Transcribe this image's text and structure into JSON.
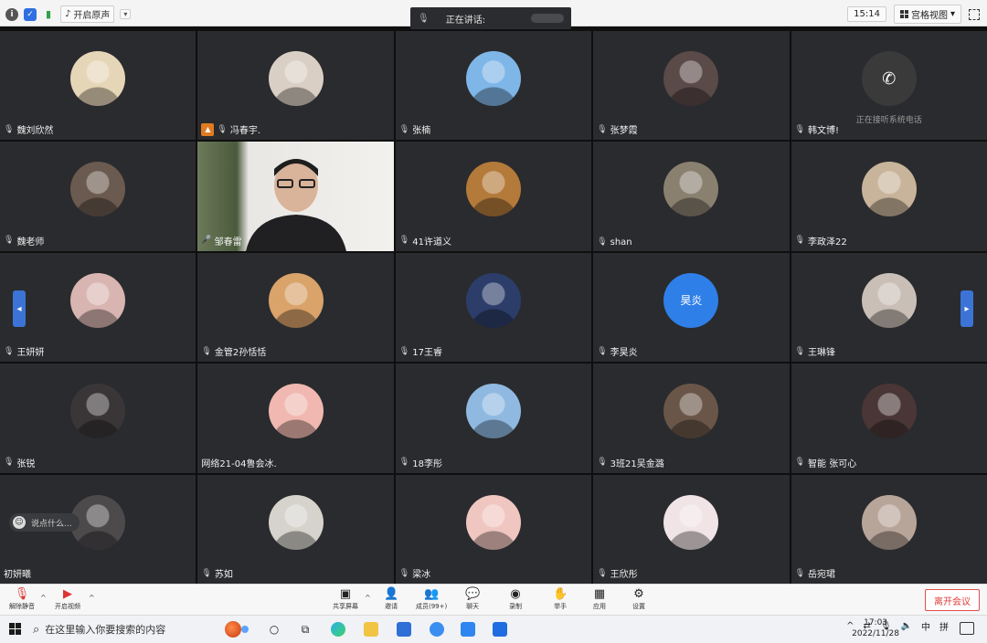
{
  "topbar": {
    "sound_label": "开启原声",
    "speaking_label": "正在讲话:",
    "time": "15:14",
    "view_label": "宫格视图"
  },
  "participants": [
    {
      "name": "魏刘欣然",
      "avatar": "#e6d6b8",
      "mic": "muted"
    },
    {
      "name": "冯春宇.",
      "avatar": "#d9cfc4",
      "mic": "muted",
      "host": true
    },
    {
      "name": "张楠",
      "avatar": "#7fb6e8",
      "mic": "muted"
    },
    {
      "name": "张梦霞",
      "avatar": "#5a4a48",
      "mic": "muted"
    },
    {
      "name": "韩文博!",
      "avatar": "#3a3a3a",
      "mic": "muted",
      "phone": true,
      "note": "正在接听系统电话"
    },
    {
      "name": "魏老师",
      "avatar": "#6b5a4f",
      "mic": "muted"
    },
    {
      "name": "邹春雷",
      "avatar": "",
      "mic": "on",
      "video": true
    },
    {
      "name": "41许道义",
      "avatar": "#b37a3a",
      "mic": "muted"
    },
    {
      "name": "shan",
      "avatar": "#8a8070",
      "mic": "muted"
    },
    {
      "name": "李政泽22",
      "avatar": "#c8b49a",
      "mic": "muted"
    },
    {
      "name": "王妍妍",
      "avatar": "#d8b5b0",
      "mic": "muted"
    },
    {
      "name": "金管2孙恬恬",
      "avatar": "#d9a36a",
      "mic": "muted"
    },
    {
      "name": "17王睿",
      "avatar": "#2c3d6a",
      "mic": "muted"
    },
    {
      "name": "李昊炎",
      "avatar": "#2f7fe8",
      "mic": "muted",
      "initials": "昊炎"
    },
    {
      "name": "王琳锋",
      "avatar": "#c9bfb6",
      "mic": "muted"
    },
    {
      "name": "张锐",
      "avatar": "#3a3638",
      "mic": "muted"
    },
    {
      "name": "网络21-04鲁会冰.",
      "avatar": "#f0b8b0",
      "mic": "none"
    },
    {
      "name": "18李彤",
      "avatar": "#8fb9e0",
      "mic": "muted"
    },
    {
      "name": "3班21吴金潞",
      "avatar": "#6a5648",
      "mic": "muted"
    },
    {
      "name": "智能 张可心",
      "avatar": "#4a3636",
      "mic": "muted"
    },
    {
      "name": "初妍曦",
      "avatar": "#4d4a4c",
      "mic": "none"
    },
    {
      "name": "苏如",
      "avatar": "#d6d2cc",
      "mic": "muted"
    },
    {
      "name": "梁冰",
      "avatar": "#f0c6c0",
      "mic": "muted"
    },
    {
      "name": "王欣彤",
      "avatar": "#f1e4e6",
      "mic": "muted"
    },
    {
      "name": "岳宛珺",
      "avatar": "#b8a59a",
      "mic": "muted"
    }
  ],
  "chat_hint": "说点什么...",
  "toolbar": {
    "unmute": "解除静音",
    "start_video": "开启视频",
    "share": "共享屏幕",
    "invite": "邀请",
    "members": "成员(99+)",
    "chat": "聊天",
    "record": "录制",
    "raise_hand": "举手",
    "apps": "应用",
    "settings": "设置",
    "leave": "离开会议"
  },
  "taskbar": {
    "search_placeholder": "在这里输入你要搜索的内容",
    "ime_lang": "中",
    "ime_mode": "拼",
    "time": "17:03",
    "date": "2022/11/28"
  },
  "colors": {
    "tile_bg": "#2a2b2e",
    "accent": "#3b74d6",
    "leave": "#e03b3b",
    "host": "#e07b22"
  }
}
